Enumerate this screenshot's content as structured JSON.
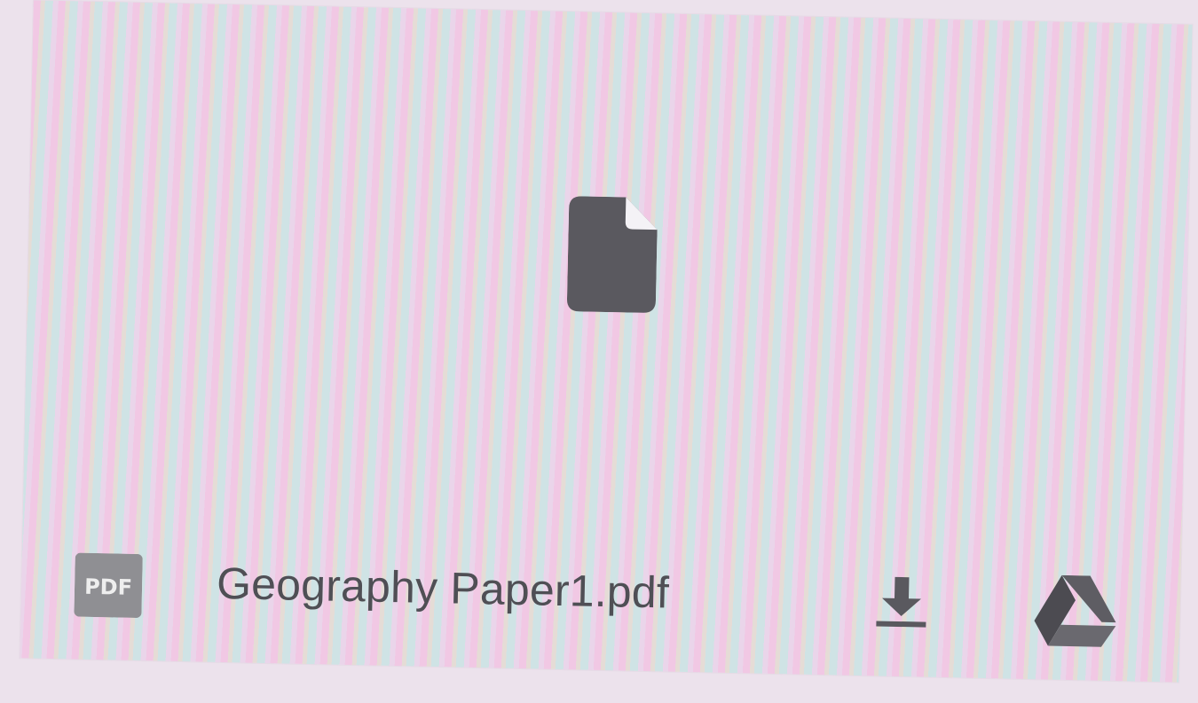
{
  "attachment": {
    "file_name": "Geography Paper1.pdf",
    "file_type_badge": "PDF",
    "preview_icon": "document-icon",
    "actions": {
      "download_icon": "download-icon",
      "drive_icon": "google-drive-icon"
    }
  },
  "colors": {
    "icon_gray": "#5a595f",
    "text_gray": "#4f4f55",
    "badge_gray": "#8f8f93"
  }
}
